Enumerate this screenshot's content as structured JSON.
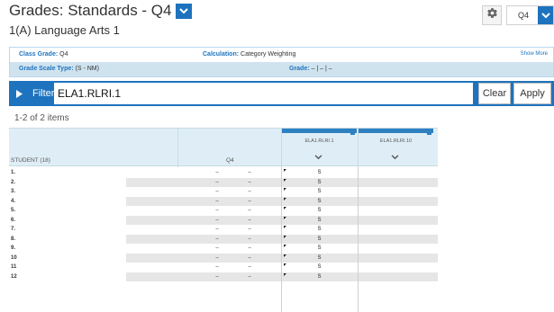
{
  "header": {
    "title": "Grades: Standards - Q4",
    "subtitle": "1(A) Language Arts 1",
    "period_selector": "Q4",
    "gear_icon": "gear-icon",
    "chevron_icon": "chevron-down-icon"
  },
  "info": {
    "class_grade_label": "Class Grade:",
    "class_grade_value": "Q4",
    "calculation_label": "Calculation:",
    "calculation_value": "Category Weighting",
    "show_more": "Show More",
    "grade_scale_label": "Grade Scale Type:",
    "grade_scale_value": "(S - NM)",
    "grade_label": "Grade:",
    "grade_value": "– | – | –"
  },
  "filter": {
    "label": "Filter",
    "value": "ELA1.RLRI.1",
    "clear_label": "Clear",
    "apply_label": "Apply"
  },
  "items_count": "1-2 of 2 items",
  "grid": {
    "student_header": "STUDENT (18)",
    "term_header": "Q4",
    "standards": [
      "ELA1.RLRI.1",
      "ELA1.RLRI.10"
    ],
    "rows": [
      {
        "num": "1.",
        "q4a": "–",
        "q4b": "–",
        "score": "S"
      },
      {
        "num": "2.",
        "q4a": "–",
        "q4b": "–",
        "score": "S"
      },
      {
        "num": "3.",
        "q4a": "–",
        "q4b": "–",
        "score": "S"
      },
      {
        "num": "4.",
        "q4a": "–",
        "q4b": "–",
        "score": "S"
      },
      {
        "num": "5.",
        "q4a": "–",
        "q4b": "–",
        "score": "S"
      },
      {
        "num": "6.",
        "q4a": "–",
        "q4b": "–",
        "score": "S"
      },
      {
        "num": "7.",
        "q4a": "–",
        "q4b": "–",
        "score": "S"
      },
      {
        "num": "8.",
        "q4a": "–",
        "q4b": "–",
        "score": "S"
      },
      {
        "num": "9.",
        "q4a": "–",
        "q4b": "–",
        "score": "S"
      },
      {
        "num": "10",
        "q4a": "–",
        "q4b": "–",
        "score": "S"
      },
      {
        "num": "11",
        "q4a": "–",
        "q4b": "–",
        "score": "S"
      },
      {
        "num": "12",
        "q4a": "–",
        "q4b": "–",
        "score": "S"
      }
    ]
  },
  "colors": {
    "accent": "#1e73be",
    "info_band": "#cfe3ef",
    "grid_header": "#dfeef6"
  }
}
